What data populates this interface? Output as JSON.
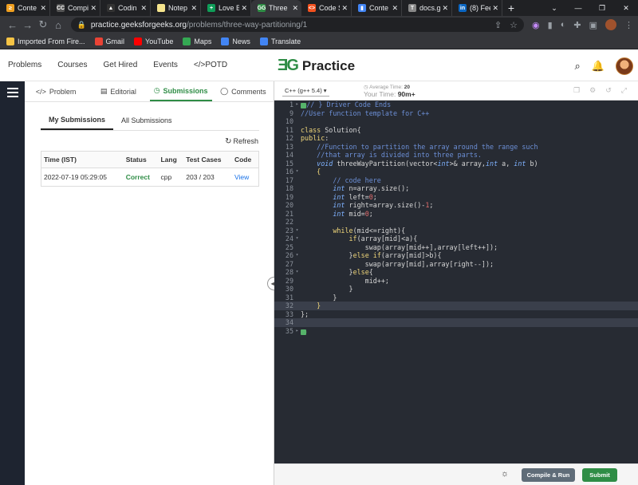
{
  "browser": {
    "tabs": [
      {
        "title": "Conte",
        "fav": "#f0a020",
        "glyph": "≥"
      },
      {
        "title": "Compi",
        "fav": "#555555",
        "glyph": "CC"
      },
      {
        "title": "Codin",
        "fav": "#333333",
        "glyph": "▲"
      },
      {
        "title": "Notep",
        "fav": "#f6e58d",
        "glyph": ""
      },
      {
        "title": "Love B",
        "fav": "#0f9d58",
        "glyph": "+"
      },
      {
        "title": "Three",
        "fav": "#2f8d46",
        "glyph": "GG",
        "active": true
      },
      {
        "title": "Code S",
        "fav": "#f4511e",
        "glyph": "<>"
      },
      {
        "title": "Conte",
        "fav": "#4285f4",
        "glyph": "▮"
      },
      {
        "title": "docs.g",
        "fav": "#888888",
        "glyph": "T"
      },
      {
        "title": "(8) Fee",
        "fav": "#0a66c2",
        "glyph": "in"
      }
    ],
    "url_host": "practice.geeksforgeeks.org",
    "url_path": "/problems/three-way-partitioning/1",
    "bookmarks": [
      {
        "label": "Imported From Fire...",
        "color": "#f6c445"
      },
      {
        "label": "Gmail",
        "color": "#ea4335"
      },
      {
        "label": "YouTube",
        "color": "#ff0000"
      },
      {
        "label": "Maps",
        "color": "#34a853"
      },
      {
        "label": "News",
        "color": "#4285f4"
      },
      {
        "label": "Translate",
        "color": "#4285f4"
      }
    ]
  },
  "header": {
    "nav": [
      "Problems",
      "Courses",
      "Get Hired",
      "Events",
      "</>POTD"
    ],
    "logo_mark": "ƎG",
    "logo_text": "Practice"
  },
  "panel": {
    "tabs": [
      {
        "icon": "</>",
        "label": "Problem"
      },
      {
        "icon": "▤",
        "label": "Editorial"
      },
      {
        "icon": "◷",
        "label": "Submissions",
        "active": true
      },
      {
        "icon": "◯",
        "label": "Comments"
      }
    ],
    "subtabs": [
      "My Submissions",
      "All Submissions"
    ],
    "refresh_label": "Refresh",
    "table": {
      "headers": [
        "Time (IST)",
        "Status",
        "Lang",
        "Test Cases",
        "Code"
      ],
      "rows": [
        [
          "2022-07-19 05:29:05",
          "Correct",
          "cpp",
          "203 / 203",
          "View"
        ]
      ]
    }
  },
  "editor": {
    "language": "C++ (g++ 5.4)",
    "avg_time_label": "Average Time:",
    "avg_time_value": "20",
    "your_time_label": "Your Time:",
    "your_time_value": "90m+",
    "compile_label": "Compile & Run",
    "submit_label": "Submit",
    "lines": [
      {
        "n": "1",
        "f": "▸",
        "html": "<span class='g'>▬▬</span><span class='c'>// } Driver Code Ends</span>"
      },
      {
        "n": "9",
        "f": "",
        "html": "<span class='c'>//User function template for C++</span>"
      },
      {
        "n": "10",
        "f": "",
        "html": ""
      },
      {
        "n": "11",
        "f": "",
        "html": "<span class='k'>class</span> Solution{"
      },
      {
        "n": "12",
        "f": "",
        "html": "<span class='k'>public</span>:"
      },
      {
        "n": "13",
        "f": "",
        "html": "    <span class='c'>//Function to partition the array around the range such</span>"
      },
      {
        "n": "14",
        "f": "",
        "html": "    <span class='c'>//that array is divided into three parts.</span>"
      },
      {
        "n": "15",
        "f": "",
        "html": "    <span class='t'>void</span> threeWayPartition(vector&lt;<span class='t'>int</span>&gt;&amp; array,<span class='t'>int</span> a, <span class='t'>int</span> b)"
      },
      {
        "n": "16",
        "f": "▾",
        "html": "    <span class='k'>{</span>"
      },
      {
        "n": "17",
        "f": "",
        "html": "        <span class='c'>// code here</span>"
      },
      {
        "n": "18",
        "f": "",
        "html": "        <span class='t'>int</span> n=array.size();"
      },
      {
        "n": "19",
        "f": "",
        "html": "        <span class='t'>int</span> left=<span class='n'>0</span>;"
      },
      {
        "n": "20",
        "f": "",
        "html": "        <span class='t'>int</span> right=array.size()-<span class='n'>1</span>;"
      },
      {
        "n": "21",
        "f": "",
        "html": "        <span class='t'>int</span> mid=<span class='n'>0</span>;"
      },
      {
        "n": "22",
        "f": "",
        "html": ""
      },
      {
        "n": "23",
        "f": "▾",
        "html": "        <span class='k'>while</span>(mid&lt;=right){"
      },
      {
        "n": "24",
        "f": "▾",
        "html": "            <span class='k'>if</span>(array[mid]&lt;a){"
      },
      {
        "n": "25",
        "f": "",
        "html": "                swap(array[mid++],array[left++]);"
      },
      {
        "n": "26",
        "f": "▾",
        "html": "            }<span class='k'>else if</span>(array[mid]&gt;b){"
      },
      {
        "n": "27",
        "f": "",
        "html": "                swap(array[mid],array[right--]);"
      },
      {
        "n": "28",
        "f": "▾",
        "html": "            }<span class='k'>else</span>{"
      },
      {
        "n": "29",
        "f": "",
        "html": "                mid++;"
      },
      {
        "n": "30",
        "f": "",
        "html": "            }"
      },
      {
        "n": "31",
        "f": "",
        "html": "        }"
      },
      {
        "n": "32",
        "f": "",
        "html": "    <span class='k'>}</span>",
        "hl": true
      },
      {
        "n": "33",
        "f": "",
        "html": "};"
      },
      {
        "n": "34",
        "f": "",
        "html": "",
        "hl": true
      },
      {
        "n": "35",
        "f": "▸",
        "html": "<span class='g'>▬▬</span>"
      }
    ]
  }
}
